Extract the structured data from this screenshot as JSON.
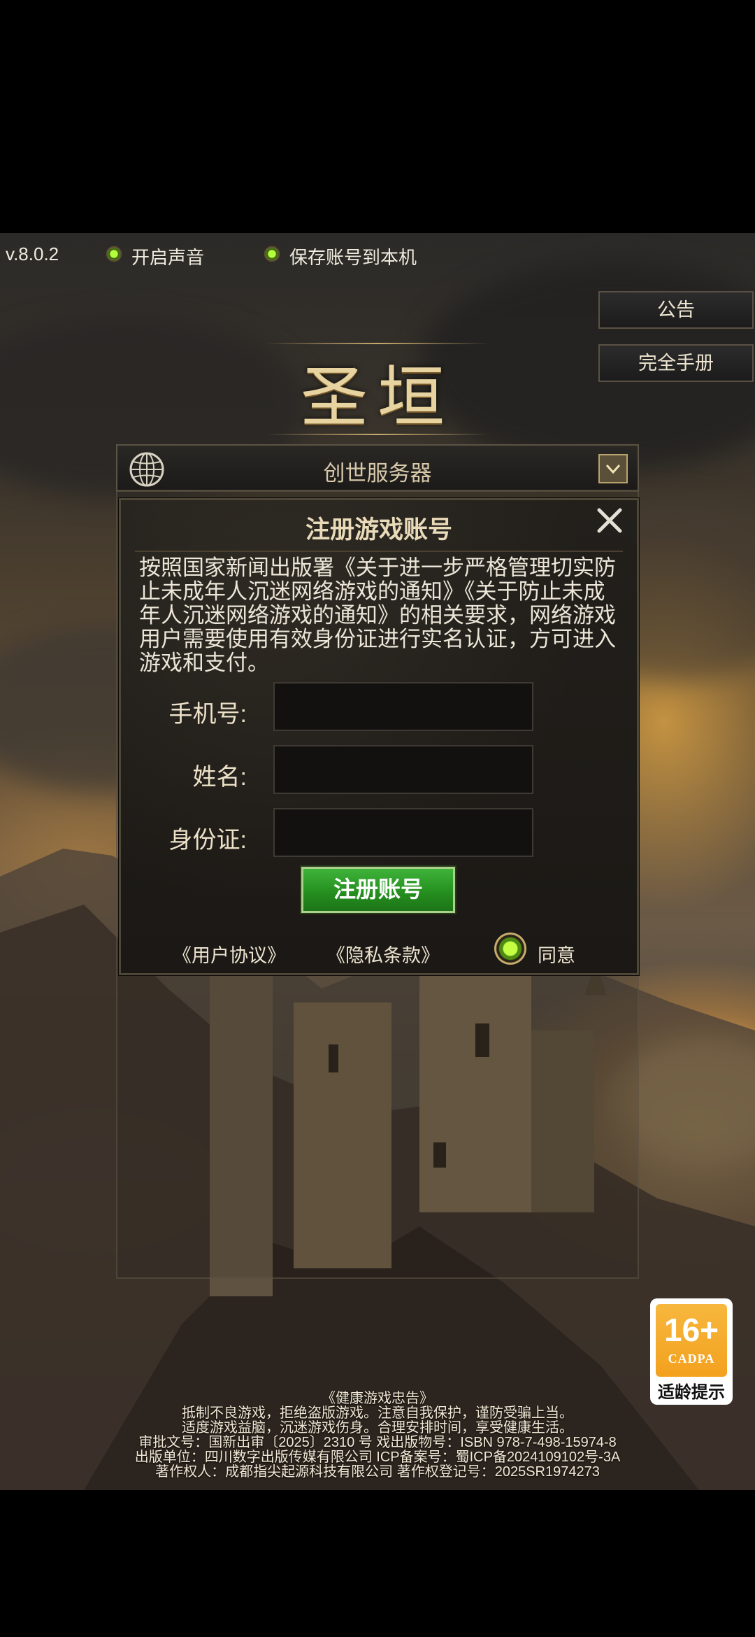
{
  "topbar": {
    "version": "v.8.0.2",
    "sound_label": "开启声音",
    "save_account_label": "保存账号到本机"
  },
  "side_buttons": {
    "announcement": "公告",
    "manual": "完全手册"
  },
  "logo": {
    "title": "圣垣"
  },
  "server": {
    "name": "创世服务器"
  },
  "dialog": {
    "title": "注册游戏账号",
    "notice": "按照国家新闻出版署《关于进一步严格管理切实防止未成年人沉迷网络游戏的通知》《关于防止未成年人沉迷网络游戏的通知》的相关要求，网络游戏用户需要使用有效身份证进行实名认证，方可进入游戏和支付。",
    "fields": {
      "phone_label": "手机号:",
      "name_label": "姓名:",
      "id_label": "身份证:"
    },
    "register_button": "注册账号",
    "user_agreement": "《用户协议》",
    "privacy_terms": "《隐私条款》",
    "agree_label": "同意"
  },
  "age_rating": {
    "age": "16+",
    "org": "CADPA",
    "tip": "适龄提示"
  },
  "footer": {
    "line1": "《健康游戏忠告》",
    "line2": "抵制不良游戏，拒绝盗版游戏。注意自我保护，谨防受骗上当。",
    "line3": "适度游戏益脑，沉迷游戏伤身。合理安排时间，享受健康生活。",
    "line4": "审批文号：国新出审〔2025〕2310 号 戏出版物号：ISBN 978-7-498-15974-8",
    "line5": "出版单位：四川数字出版传媒有限公司 ICP备案号：蜀ICP备2024109102号-3A",
    "line6": "著作权人：成都指尖起源科技有限公司    著作权登记号：2025SR1974273"
  },
  "colors": {
    "accent_green": "#2fa52a",
    "gold_text": "#e9dbb9",
    "badge_orange": "#f3a11e"
  }
}
